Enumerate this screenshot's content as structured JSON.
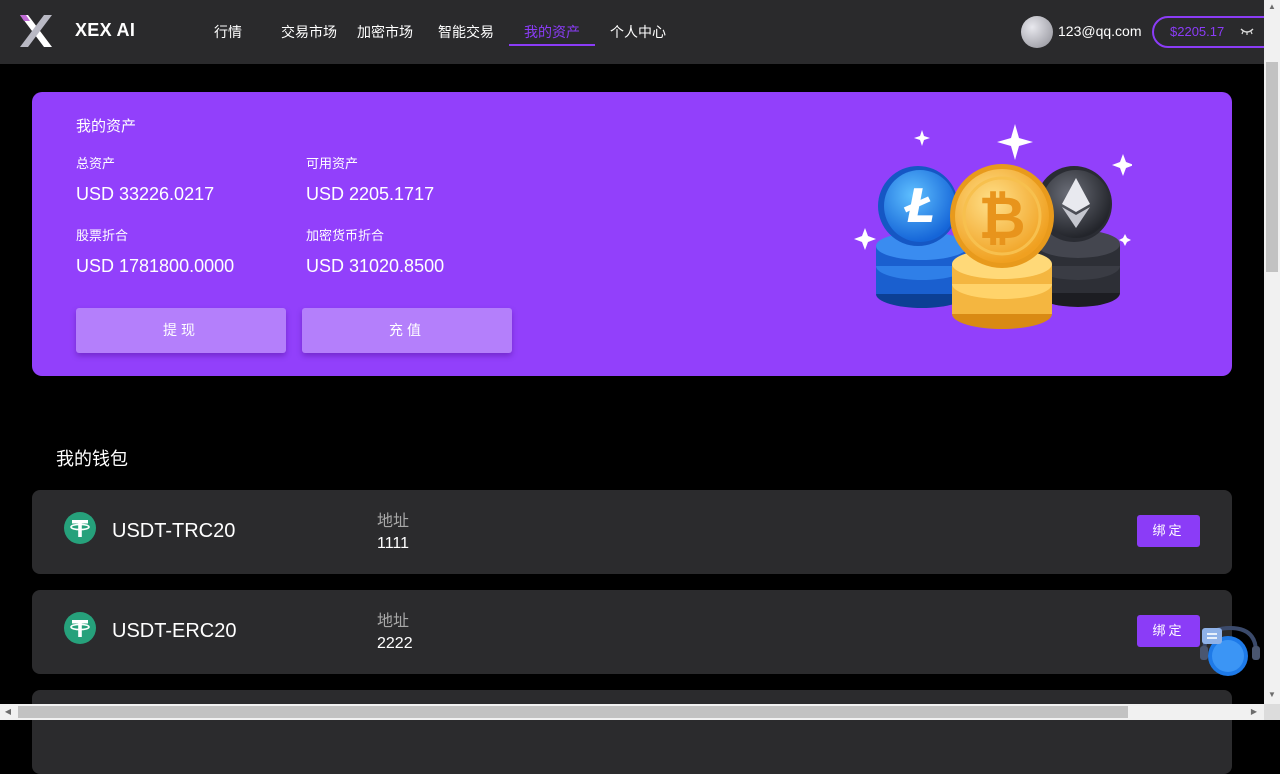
{
  "header": {
    "brand": "XEX AI",
    "nav": [
      {
        "label": "行情"
      },
      {
        "label": "交易市场"
      },
      {
        "label": "加密市场"
      },
      {
        "label": "智能交易"
      },
      {
        "label": "我的资产",
        "active": true
      },
      {
        "label": "个人中心"
      }
    ],
    "user_email": "123@qq.com",
    "balance": "$2205.17",
    "accent_color": "#8b3cf7"
  },
  "assets": {
    "title": "我的资产",
    "total_label": "总资产",
    "total_value": "USD 33226.0217",
    "available_label": "可用资产",
    "available_value": "USD 2205.1717",
    "stock_label": "股票折合",
    "stock_value": "USD 1781800.0000",
    "crypto_label": "加密货币折合",
    "crypto_value": "USD 31020.8500",
    "withdraw_label": "提现",
    "deposit_label": "充值",
    "card_color": "#9240fb"
  },
  "wallet": {
    "title": "我的钱包",
    "items": [
      {
        "name": "USDT-TRC20",
        "address_label": "地址",
        "address": "1111",
        "bind_label": "绑定",
        "icon": "tether-icon"
      },
      {
        "name": "USDT-ERC20",
        "address_label": "地址",
        "address": "2222",
        "bind_label": "绑定",
        "icon": "tether-icon"
      }
    ]
  }
}
